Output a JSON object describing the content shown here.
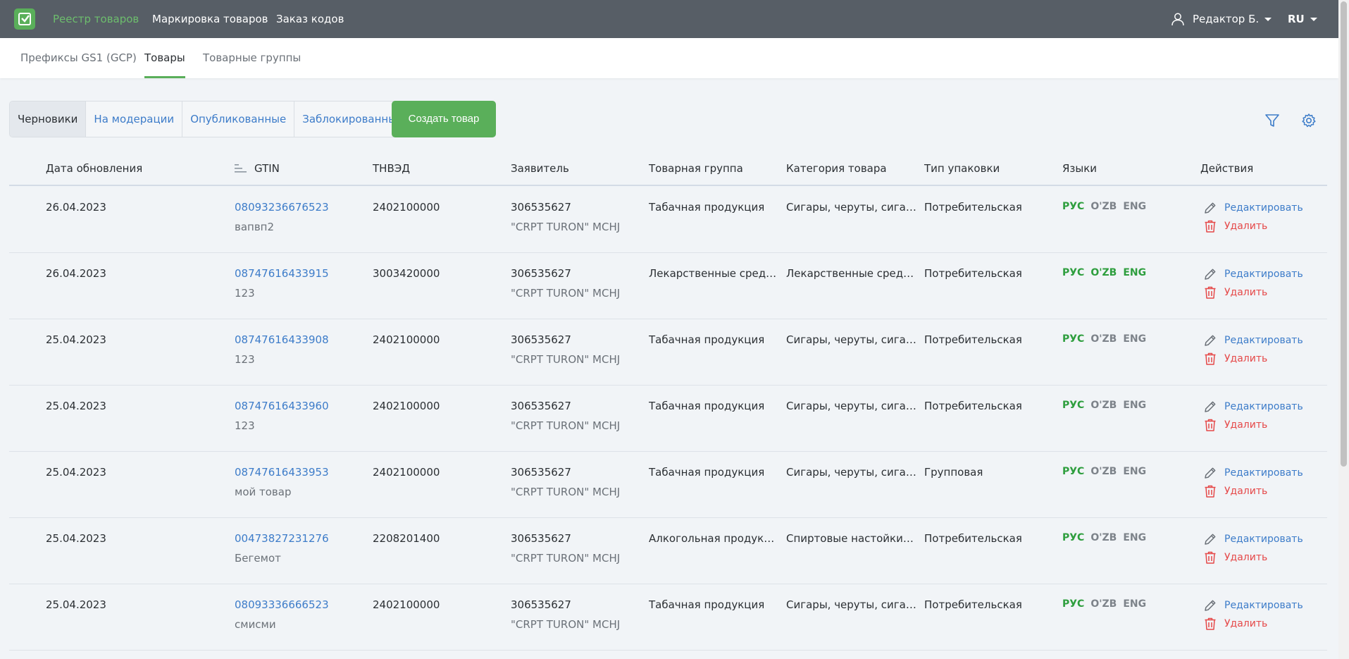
{
  "topbar": {
    "nav": [
      "Реестр товаров",
      "Маркировка товаров",
      "Заказ кодов"
    ],
    "user_name": "Редактор Б.",
    "language": "RU",
    "colors": {
      "bar": "#575e66",
      "active": "#6dbd6d",
      "accent": "#5aaf5a"
    }
  },
  "subnav": {
    "tabs": [
      "Префиксы GS1 (GCP)",
      "Товары",
      "Товарные группы"
    ]
  },
  "filters": {
    "statuses": [
      "Черновики",
      "На модерации",
      "Опубликованные",
      "Заблокированные"
    ],
    "create_button": "Создать товар",
    "icons": [
      "filter-icon",
      "settings-icon"
    ]
  },
  "table": {
    "headers": [
      "Дата обновления",
      "GTIN",
      "ТНВЭД",
      "Заявитель",
      "Товарная группа",
      "Категория товара",
      "Тип упаковки",
      "Языки",
      "Действия"
    ],
    "lang_labels": [
      "РУС",
      "O'ZB",
      "ENG"
    ],
    "edit_label": "Редактировать",
    "delete_label": "Удалить",
    "rows": [
      {
        "date": "26.04.2023",
        "gtin": "08093236676523",
        "name": "вапвп2",
        "tnved": "2402100000",
        "inn": "306535627",
        "applicant": "\"CRPT TURON\" MCHJ",
        "group": "Табачная продукция",
        "category": "Сигары, черуты, сигари...",
        "pack": "Потребительская",
        "langs_on": [
          true,
          false,
          false
        ]
      },
      {
        "date": "26.04.2023",
        "gtin": "08747616433915",
        "name": "123",
        "tnved": "3003420000",
        "inn": "306535627",
        "applicant": "\"CRPT TURON\" MCHJ",
        "group": "Лекарственные средства",
        "category": "Лекарственные средств...",
        "pack": "Потребительская",
        "langs_on": [
          true,
          true,
          true
        ]
      },
      {
        "date": "25.04.2023",
        "gtin": "08747616433908",
        "name": "123",
        "tnved": "2402100000",
        "inn": "306535627",
        "applicant": "\"CRPT TURON\" MCHJ",
        "group": "Табачная продукция",
        "category": "Сигары, черуты, сигари...",
        "pack": "Потребительская",
        "langs_on": [
          true,
          false,
          false
        ]
      },
      {
        "date": "25.04.2023",
        "gtin": "08747616433960",
        "name": "123",
        "tnved": "2402100000",
        "inn": "306535627",
        "applicant": "\"CRPT TURON\" MCHJ",
        "group": "Табачная продукция",
        "category": "Сигары, черуты, сигари...",
        "pack": "Потребительская",
        "langs_on": [
          true,
          false,
          false
        ]
      },
      {
        "date": "25.04.2023",
        "gtin": "08747616433953",
        "name": "мой товар",
        "tnved": "2402100000",
        "inn": "306535627",
        "applicant": "\"CRPT TURON\" MCHJ",
        "group": "Табачная продукция",
        "category": "Сигары, черуты, сигари...",
        "pack": "Групповая",
        "langs_on": [
          true,
          false,
          false
        ]
      },
      {
        "date": "25.04.2023",
        "gtin": "00473827231276",
        "name": "Бегемот",
        "tnved": "2208201400",
        "inn": "306535627",
        "applicant": "\"CRPT TURON\" MCHJ",
        "group": "Алкогольная продукция",
        "category": "Спиртовые настойки, по...",
        "pack": "Потребительская",
        "langs_on": [
          true,
          false,
          false
        ]
      },
      {
        "date": "25.04.2023",
        "gtin": "08093336666523",
        "name": "смисми",
        "tnved": "2402100000",
        "inn": "306535627",
        "applicant": "\"CRPT TURON\" MCHJ",
        "group": "Табачная продукция",
        "category": "Сигары, черуты, сигари...",
        "pack": "Потребительская",
        "langs_on": [
          true,
          false,
          false
        ]
      }
    ]
  }
}
